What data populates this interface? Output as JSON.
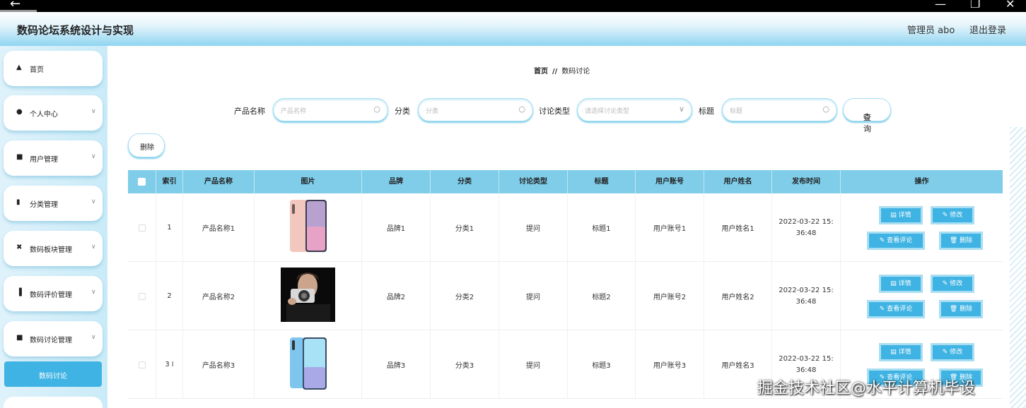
{
  "window": {
    "back_icon": "←",
    "minimize_icon": "—",
    "restore_icon": "❐",
    "close_icon": "✕"
  },
  "header": {
    "title": "数码论坛系统设计与实现",
    "admin": "管理员 abo",
    "logout": "退出登录"
  },
  "sidebar": {
    "items": [
      {
        "icon": "home-icon",
        "label": "首页"
      },
      {
        "icon": "user-icon",
        "label": "个人中心"
      },
      {
        "icon": "grid-icon",
        "label": "用户管理"
      },
      {
        "icon": "chart-icon",
        "label": "分类管理"
      },
      {
        "icon": "cross-icon",
        "label": "数码板块管理"
      },
      {
        "icon": "bar-chart-icon",
        "label": "数码评价管理"
      },
      {
        "icon": "grid-icon",
        "label": "数码讨论管理"
      }
    ],
    "active_label": "数码讨论"
  },
  "breadcrumb": {
    "home": "首页",
    "separator": "//",
    "current": "数码讨论"
  },
  "filters": {
    "product_label": "产品名称",
    "product_placeholder": "产品名称",
    "category_label": "分类",
    "category_placeholder": "分类",
    "type_label": "讨论类型",
    "type_placeholder": "请选择讨论类型",
    "title_label": "标题",
    "title_placeholder": "标题",
    "query_button": "查询"
  },
  "delete_button": "删除",
  "table": {
    "columns": [
      "索引",
      "产品名称",
      "图片",
      "品牌",
      "分类",
      "讨论类型",
      "标题",
      "用户账号",
      "用户姓名",
      "发布时间",
      "操作"
    ],
    "rows": [
      {
        "index": "1",
        "product": "产品名称1",
        "image": "phone-pink-icon",
        "brand": "品牌1",
        "category": "分类1",
        "type": "提问",
        "title": "标题1",
        "account": "用户账号1",
        "name": "用户姓名1",
        "time_date": "2022-03-22 15:",
        "time_clock": "36:48"
      },
      {
        "index": "2",
        "product": "产品名称2",
        "image": "camera-photo-icon",
        "brand": "品牌2",
        "category": "分类2",
        "type": "提问",
        "title": "标题2",
        "account": "用户账号2",
        "name": "用户姓名2",
        "time_date": "2022-03-22 15:",
        "time_clock": "36:48"
      },
      {
        "index": "3",
        "product": "产品名称3",
        "image": "phone-blue-icon",
        "brand": "品牌3",
        "category": "分类3",
        "type": "提问",
        "title": "标题3",
        "account": "用户账号3",
        "name": "用户姓名3",
        "time_date": "2022-03-22 15:",
        "time_clock": "36:48"
      }
    ],
    "actions": {
      "detail": "详情",
      "edit": "修改",
      "comments": "查看评论",
      "delete": "删除"
    }
  },
  "watermark": "掘金技术社区@水平计算机毕设"
}
